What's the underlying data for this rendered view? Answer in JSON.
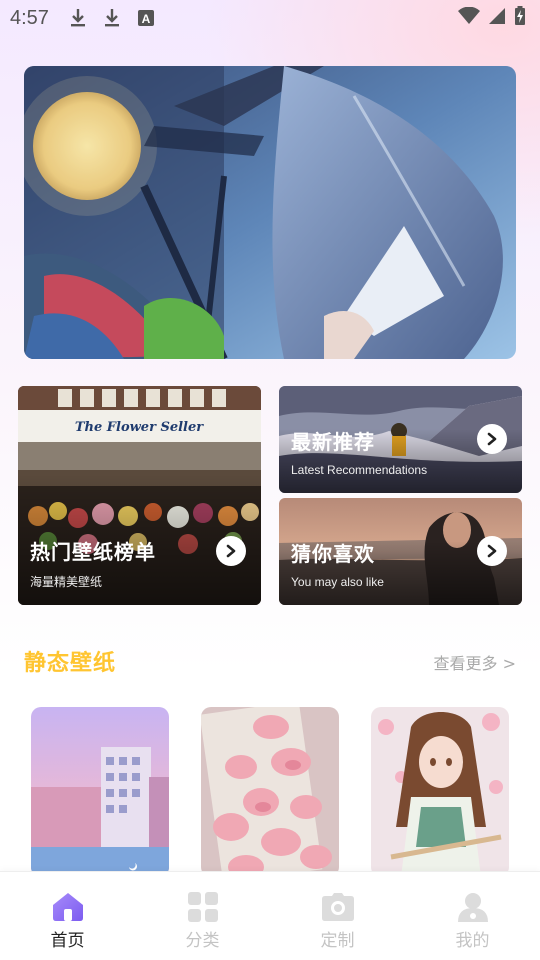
{
  "status_bar": {
    "time": "4:57",
    "left_icons": [
      "download-icon",
      "download-icon",
      "font-a-icon"
    ],
    "right_icons": [
      "wifi-icon",
      "signal-icon",
      "battery-icon"
    ]
  },
  "hero": {
    "image": "anime-moon-night-banner"
  },
  "cards": [
    {
      "title": "热门壁纸榜单",
      "subtitle": "海量精美壁纸",
      "image": "flower-shop-photo"
    },
    {
      "title": "最新推荐",
      "subtitle": "Latest Recommendations",
      "image": "snowy-mountain-photo"
    },
    {
      "title": "猜你喜欢",
      "subtitle": "You may also like",
      "image": "seaside-sunset-photo"
    }
  ],
  "section": {
    "title": "静态壁纸",
    "more": "查看更多 >"
  },
  "thumbnails": [
    "pastel-city-building",
    "pink-rose-petals",
    "anime-girl-flowers"
  ],
  "tabs": [
    {
      "label": "首页",
      "icon": "home-icon",
      "active": true
    },
    {
      "label": "分类",
      "icon": "grid-icon",
      "active": false
    },
    {
      "label": "定制",
      "icon": "camera-icon",
      "active": false
    },
    {
      "label": "我的",
      "icon": "user-icon",
      "active": false
    }
  ],
  "colors": {
    "accent": "#ffc531",
    "tab_active_icon": "#8b6cf5",
    "tab_inactive": "#c4c4c4"
  }
}
